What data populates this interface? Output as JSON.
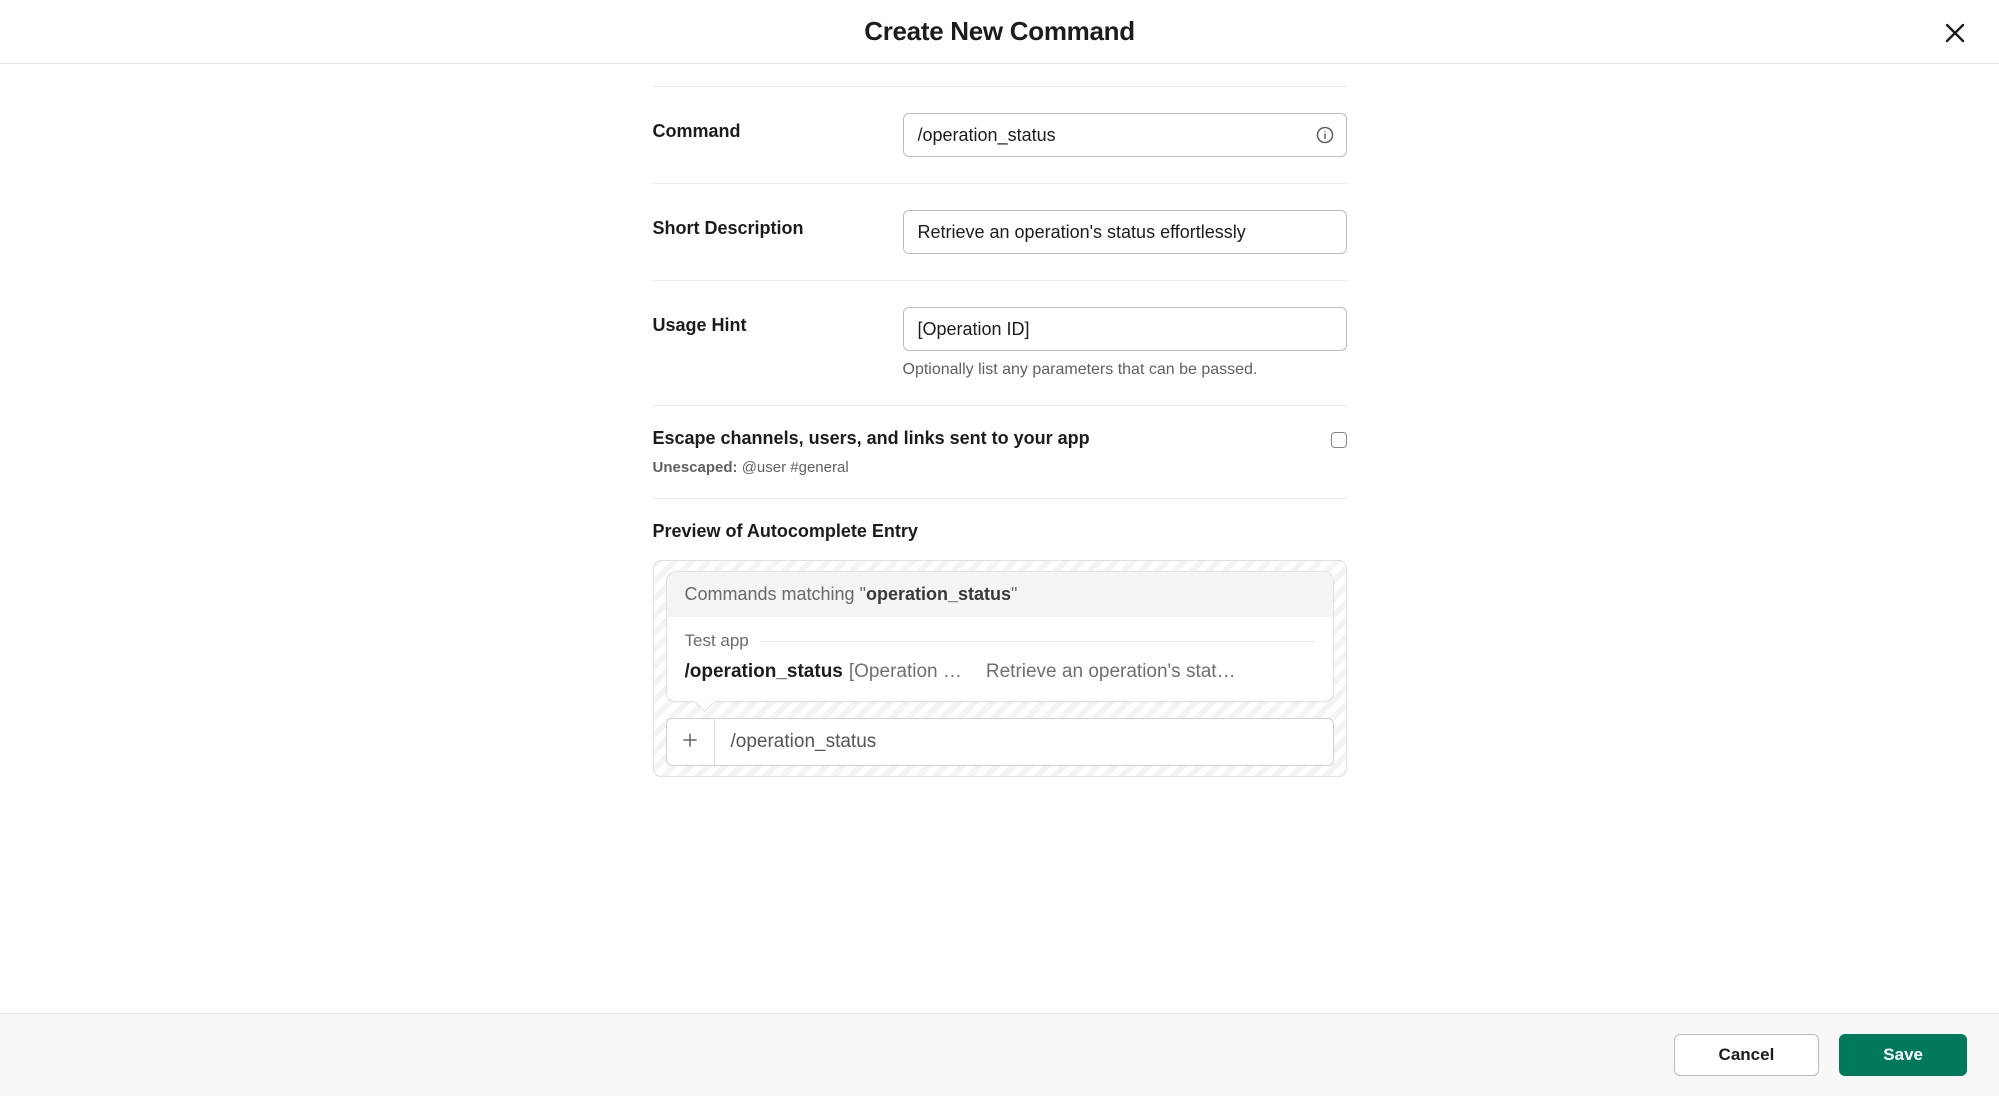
{
  "header": {
    "title": "Create New Command"
  },
  "form": {
    "command": {
      "label": "Command",
      "value": "/operation_status"
    },
    "short_description": {
      "label": "Short Description",
      "value": "Retrieve an operation's status effortlessly"
    },
    "usage_hint": {
      "label": "Usage Hint",
      "value": "[Operation ID]",
      "help": "Optionally list any parameters that can be passed."
    },
    "escape": {
      "label": "Escape channels, users, and links sent to your app",
      "sub_prefix": "Unescaped:",
      "sub_value": "@user #general",
      "checked": false
    }
  },
  "preview": {
    "title": "Preview of Autocomplete Entry",
    "matching_prefix": "Commands matching \"",
    "matching_term": "operation_status",
    "matching_suffix": "\"",
    "app_name": "Test app",
    "entry_command": "/operation_status",
    "entry_hint": "[Operation …",
    "entry_description": "Retrieve an operation's stat…",
    "compose_text": "/operation_status"
  },
  "footer": {
    "cancel": "Cancel",
    "save": "Save"
  },
  "colors": {
    "primary": "#007a5a",
    "border": "#e8e8e8",
    "text": "#1d1c1d",
    "muted": "#616061"
  }
}
